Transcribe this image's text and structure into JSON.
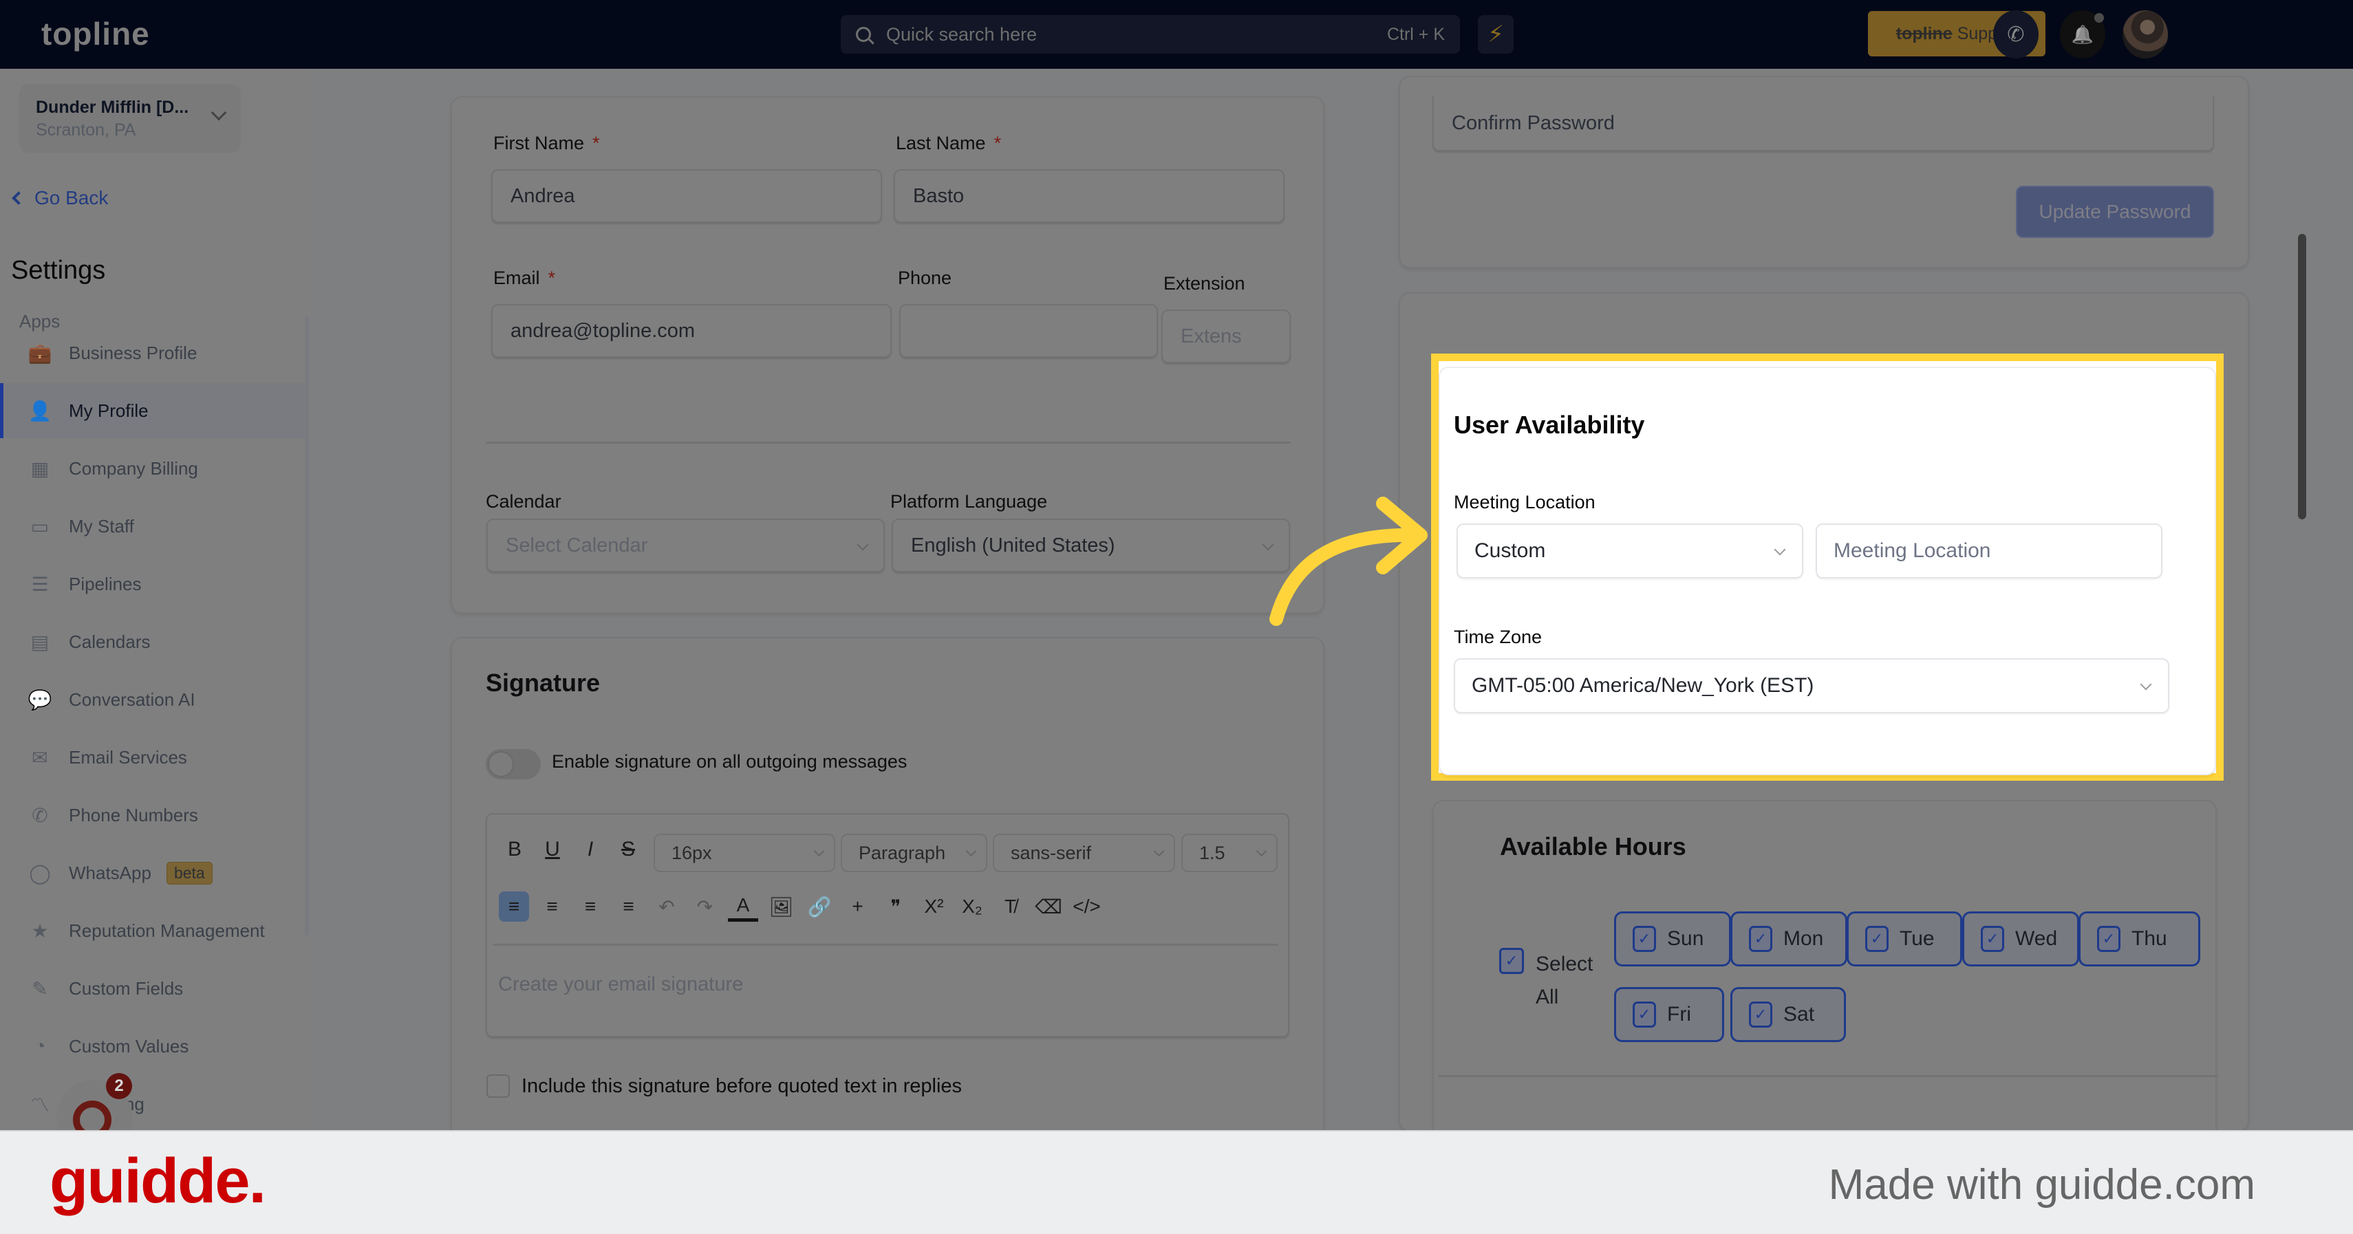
{
  "topbar": {
    "logo": "topline",
    "search_placeholder": "Quick search here",
    "search_shortcut": "Ctrl + K",
    "bolt_icon": "⚡",
    "support_brand": "topline",
    "support_label": "Support",
    "phone_icon": "✆",
    "bell_icon": "🔔"
  },
  "sidebar": {
    "location_name": "Dunder Mifflin [D...",
    "location_sub": "Scranton, PA",
    "go_back": "Go Back",
    "heading": "Settings",
    "section": "Apps",
    "items": [
      {
        "label": "Business Profile",
        "icon": "💼"
      },
      {
        "label": "My Profile",
        "icon": "👤",
        "active": true
      },
      {
        "label": "Company Billing",
        "icon": "▦"
      },
      {
        "label": "My Staff",
        "icon": "▭"
      },
      {
        "label": "Pipelines",
        "icon": "☰"
      },
      {
        "label": "Calendars",
        "icon": "▤"
      },
      {
        "label": "Conversation AI",
        "icon": "💬"
      },
      {
        "label": "Email Services",
        "icon": "✉"
      },
      {
        "label": "Phone Numbers",
        "icon": "✆"
      },
      {
        "label": "WhatsApp",
        "icon": "◯",
        "badge": "beta"
      },
      {
        "label": "Reputation Management",
        "icon": "★"
      },
      {
        "label": "Custom Fields",
        "icon": "✎"
      },
      {
        "label": "Custom Values",
        "icon": "◔"
      },
      {
        "label": "e Scoring",
        "icon": "〽"
      }
    ],
    "helper_badge": "2"
  },
  "profile": {
    "first_name_label": "First Name",
    "first_name": "Andrea",
    "last_name_label": "Last Name",
    "last_name": "Basto",
    "required_mark": "*",
    "email_label": "Email",
    "email": "andrea@topline.com",
    "phone_label": "Phone",
    "phone": "",
    "extension_label": "Extension",
    "extension_placeholder": "Extens",
    "calendar_label": "Calendar",
    "calendar_placeholder": "Select Calendar",
    "language_label": "Platform Language",
    "language": "English (United States)"
  },
  "signature": {
    "title": "Signature",
    "enable_label": "Enable signature on all outgoing messages",
    "enabled": false,
    "toolbar": {
      "bold": "B",
      "underline": "U",
      "italic": "I",
      "strike": "S",
      "font_size": "16px",
      "block": "Paragraph",
      "font_family": "sans-serif",
      "line_height": "1.5",
      "row2": [
        "≡",
        "≡",
        "≡",
        "≡",
        "↶",
        "↷",
        "A",
        "🖼",
        "🔗",
        "+",
        "❞",
        "X²",
        "X₂",
        "T̸",
        "⌫",
        "</>"
      ]
    },
    "placeholder": "Create your email signature",
    "include_label": "Include this signature before quoted text in replies",
    "include_checked": false
  },
  "password": {
    "confirm_placeholder": "Confirm Password",
    "update_button": "Update Password"
  },
  "availability": {
    "title": "User Availability",
    "meeting_location_label": "Meeting Location",
    "meeting_type": "Custom",
    "meeting_location_placeholder": "Meeting Location",
    "timezone_label": "Time Zone",
    "timezone": "GMT-05:00 America/New_York (EST)"
  },
  "hours": {
    "title": "Available Hours",
    "select_all": "Select All",
    "select_all_checked": true,
    "days": [
      {
        "label": "Sun",
        "checked": true
      },
      {
        "label": "Mon",
        "checked": true
      },
      {
        "label": "Tue",
        "checked": true
      },
      {
        "label": "Wed",
        "checked": true
      },
      {
        "label": "Thu",
        "checked": true
      },
      {
        "label": "Fri",
        "checked": true
      },
      {
        "label": "Sat",
        "checked": true
      }
    ]
  },
  "footer": {
    "brand": "guidde.",
    "made_with": "Made with guidde.com"
  },
  "colors": {
    "highlight": "#ffd43b",
    "brand_red": "#cc0000",
    "accent_blue": "#1e3a8a",
    "topbar": "#030818"
  }
}
